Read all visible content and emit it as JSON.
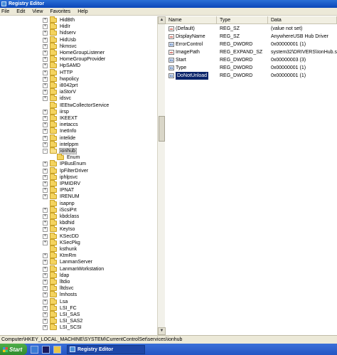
{
  "window": {
    "title": "Registry Editor"
  },
  "menu": [
    "File",
    "Edit",
    "View",
    "Favorites",
    "Help"
  ],
  "tree": [
    {
      "label": "HidBth",
      "exp": true
    },
    {
      "label": "HidIr",
      "exp": true
    },
    {
      "label": "hidserv",
      "exp": true
    },
    {
      "label": "HidUsb",
      "exp": true
    },
    {
      "label": "hkmsvc",
      "exp": true
    },
    {
      "label": "HomeGroupListener",
      "exp": true
    },
    {
      "label": "HomeGroupProvider",
      "exp": true
    },
    {
      "label": "HpSAMD",
      "exp": true
    },
    {
      "label": "HTTP",
      "exp": true
    },
    {
      "label": "hwpolicy",
      "exp": true
    },
    {
      "label": "i8042prt",
      "exp": true
    },
    {
      "label": "iaStorV",
      "exp": true
    },
    {
      "label": "idsvc",
      "exp": true
    },
    {
      "label": "IEEtwCollectorService",
      "exp": false
    },
    {
      "label": "iirsp",
      "exp": true
    },
    {
      "label": "IKEEXT",
      "exp": true
    },
    {
      "label": "inetaccs",
      "exp": true
    },
    {
      "label": "InetInfo",
      "exp": true
    },
    {
      "label": "intelide",
      "exp": true
    },
    {
      "label": "intelppm",
      "exp": true
    },
    {
      "label": "ionhub",
      "exp": true,
      "open": true,
      "selected": true
    },
    {
      "label": "Enum",
      "exp": false,
      "child": true
    },
    {
      "label": "IPBusEnum",
      "exp": true
    },
    {
      "label": "IpFilterDriver",
      "exp": true
    },
    {
      "label": "iphlpsvc",
      "exp": true
    },
    {
      "label": "IPMIDRV",
      "exp": true
    },
    {
      "label": "IPNAT",
      "exp": true
    },
    {
      "label": "IRENUM",
      "exp": true
    },
    {
      "label": "isapnp",
      "exp": false
    },
    {
      "label": "iScsiPrt",
      "exp": true
    },
    {
      "label": "kbdclass",
      "exp": true
    },
    {
      "label": "kbdhid",
      "exp": true
    },
    {
      "label": "KeyIso",
      "exp": true
    },
    {
      "label": "KSecDD",
      "exp": true
    },
    {
      "label": "KSecPkg",
      "exp": true
    },
    {
      "label": "ksthunk",
      "exp": false
    },
    {
      "label": "KtmRm",
      "exp": true
    },
    {
      "label": "LanmanServer",
      "exp": true
    },
    {
      "label": "LanmanWorkstation",
      "exp": true
    },
    {
      "label": "ldap",
      "exp": true
    },
    {
      "label": "lltdio",
      "exp": true
    },
    {
      "label": "lltdsvc",
      "exp": true
    },
    {
      "label": "lmhosts",
      "exp": true
    },
    {
      "label": "Lsa",
      "exp": true
    },
    {
      "label": "LSI_FC",
      "exp": true
    },
    {
      "label": "LSI_SAS",
      "exp": true
    },
    {
      "label": "LSI_SAS2",
      "exp": true
    },
    {
      "label": "LSI_SCSI",
      "exp": true
    }
  ],
  "columns": {
    "name": "Name",
    "type": "Type",
    "data": "Data"
  },
  "values": [
    {
      "name": "(Default)",
      "type": "REG_SZ",
      "data": "(value not set)",
      "kind": "sz"
    },
    {
      "name": "DisplayName",
      "type": "REG_SZ",
      "data": "AnywhereUSB Hub Driver",
      "kind": "sz"
    },
    {
      "name": "ErrorControl",
      "type": "REG_DWORD",
      "data": "0x00000001 (1)",
      "kind": "dw"
    },
    {
      "name": "ImagePath",
      "type": "REG_EXPAND_SZ",
      "data": "system32\\DRIVERS\\IonHub.sys",
      "kind": "sz"
    },
    {
      "name": "Start",
      "type": "REG_DWORD",
      "data": "0x00000003 (3)",
      "kind": "dw"
    },
    {
      "name": "Type",
      "type": "REG_DWORD",
      "data": "0x00000001 (1)",
      "kind": "dw"
    },
    {
      "name": "DoNotUnload",
      "type": "REG_DWORD",
      "data": "0x00000001 (1)",
      "kind": "dw",
      "selected": true
    }
  ],
  "status": {
    "path": "Computer\\HKEY_LOCAL_MACHINE\\SYSTEM\\CurrentControlSet\\services\\ionhub"
  },
  "taskbar": {
    "start_label": "Start",
    "task_label": "Registry Editor"
  }
}
